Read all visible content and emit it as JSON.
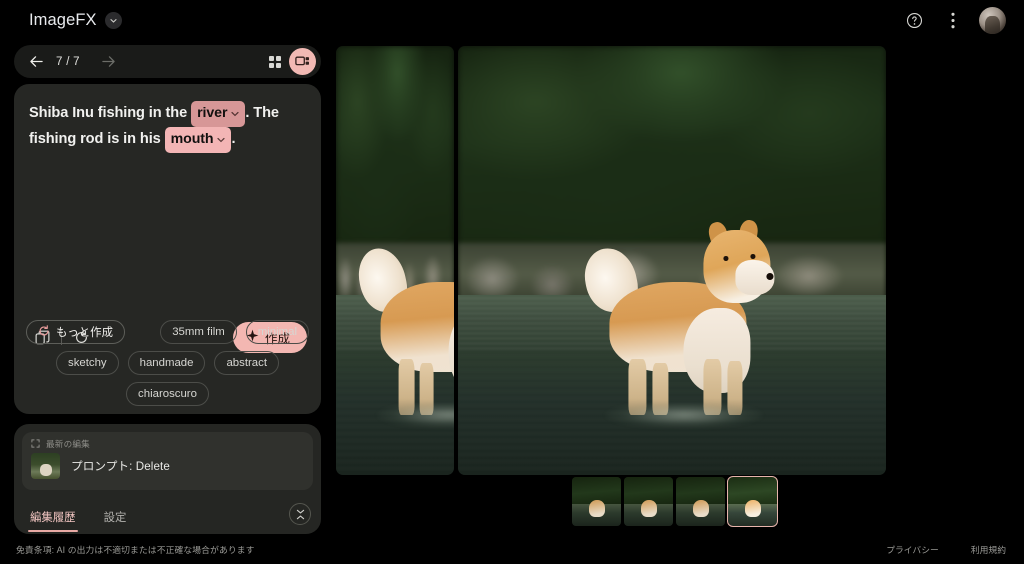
{
  "app": {
    "title": "ImageFX",
    "brand_dropdown_icon": "chevron-down-icon"
  },
  "topbar": {
    "help_icon": "help-circle-icon",
    "menu_icon": "more-vertical-icon",
    "avatar": "user-avatar"
  },
  "navigation": {
    "back_icon": "arrow-left-icon",
    "forward_icon": "arrow-right-icon",
    "counter": "7 / 7",
    "grid_view_icon": "grid-view-icon",
    "compare_view_icon": "compare-view-icon"
  },
  "prompt": {
    "part1": "Shiba Inu fishing in the ",
    "chip1": "river",
    "part2": ". The fishing rod is in his ",
    "chip2": "mouth",
    "part3": ".",
    "chip_dropdown_icon": "chevron-down-icon",
    "copy_icon": "copy-icon",
    "reset_icon": "refresh-icon",
    "create_label": "作成",
    "create_icon": "sparkle-icon",
    "create_color": "#f3b7b2"
  },
  "style_chips": [
    {
      "label": "もっと作成",
      "icon": "refresh-icon",
      "primary": true
    },
    {
      "label": "35mm film",
      "icon": null,
      "primary": false
    },
    {
      "label": "minimal",
      "icon": null,
      "primary": false
    },
    {
      "label": "sketchy",
      "icon": null,
      "primary": false
    },
    {
      "label": "handmade",
      "icon": null,
      "primary": false
    },
    {
      "label": "abstract",
      "icon": null,
      "primary": false
    },
    {
      "label": "chiaroscuro",
      "icon": null,
      "primary": false
    }
  ],
  "history": {
    "section_label": "最新の編集",
    "section_icon": "expand-icon",
    "entry_label": "プロンプト: Delete",
    "entry_thumb": "history-thumbnail",
    "tabs": [
      {
        "label": "編集履歴",
        "active": true
      },
      {
        "label": "設定",
        "active": false
      }
    ],
    "collapse_icon": "collapse-icon",
    "accent_color": "#e8a9a4"
  },
  "thumbnails": [
    {
      "name": "variant-1",
      "selected": false
    },
    {
      "name": "variant-2",
      "selected": false
    },
    {
      "name": "variant-3",
      "selected": false
    },
    {
      "name": "variant-4",
      "selected": true
    }
  ],
  "images": {
    "left_panel": "generated-image-previous",
    "right_panel": "generated-image-current"
  },
  "footer": {
    "disclaimer": "免責条項: AI の出力は不適切または不正確な場合があります",
    "privacy": "プライバシー",
    "terms": "利用規約"
  }
}
